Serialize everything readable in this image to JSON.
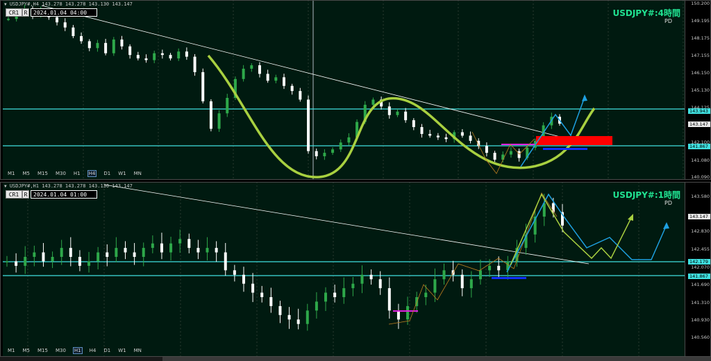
{
  "top": {
    "symbol_line": "USDJPY#,H4 143.278 143.278 143.130 143.147",
    "cr_label": "CR1",
    "r_label": "R",
    "date_label": "2024.01.04 04:00",
    "title": "USDJPY#:4時間",
    "pd": "PD",
    "timeframes": [
      "M1",
      "M5",
      "M15",
      "M30",
      "H1",
      "H4",
      "D1",
      "W1",
      "MN"
    ],
    "active_timeframe": "H4",
    "price_ticks": [
      "150.200",
      "149.195",
      "148.175",
      "147.155",
      "146.150",
      "145.130",
      "144.125",
      "143.105",
      "142.100",
      "141.080",
      "140.090"
    ],
    "levels": {
      "upper": "143.943",
      "current": "143.147",
      "lower": "141.867"
    }
  },
  "bottom": {
    "symbol_line": "USDJPY#,H1 143.278 143.278 143.130 143.147",
    "cr_label": "CR1",
    "r_label": "R",
    "date_label": "2024.01.04 01:00",
    "title": "USDJPY#:1時間",
    "pd": "PD",
    "timeframes": [
      "M1",
      "M5",
      "M15",
      "M30",
      "H1",
      "H4",
      "D1",
      "W1",
      "MN"
    ],
    "active_timeframe": "H1",
    "price_ticks": [
      "143.580",
      "143.147",
      "142.830",
      "142.455",
      "142.070",
      "141.690",
      "141.310",
      "140.930",
      "140.560"
    ],
    "levels": {
      "current": "143.147",
      "upper": "142.179",
      "lower": "141.867"
    }
  },
  "colors": {
    "background": "#001a10",
    "bull": "#2ea84a",
    "bear": "#ffffff",
    "level_line": "#40e0e0",
    "trend_line": "#ffffff",
    "curve": "#a8d040",
    "forecast": "#1ea0e0",
    "zone_red": "#ff0000",
    "zone_blue": "#1030ff",
    "zone_magenta": "#e020e0",
    "title": "#20e090"
  },
  "chart_data": [
    {
      "type": "candlestick",
      "timeframe": "H4",
      "ylim": [
        140.09,
        150.2
      ],
      "close_path": [
        149.3,
        149.6,
        149.9,
        149.5,
        149.8,
        149.4,
        149.1,
        148.8,
        148.3,
        148.0,
        147.6,
        147.9,
        147.3,
        148.1,
        147.7,
        147.2,
        147.0,
        146.9,
        147.3,
        147.2,
        147.0,
        147.4,
        147.1,
        146.2,
        144.5,
        142.9,
        143.8,
        144.7,
        145.8,
        146.4,
        146.6,
        146.1,
        145.7,
        145.9,
        145.4,
        145.1,
        144.6,
        141.6,
        141.3,
        141.5,
        141.7,
        142.1,
        142.4,
        143.3,
        144.3,
        144.6,
        144.2,
        143.7,
        143.9,
        143.4,
        143.0,
        142.6,
        142.5,
        142.4,
        142.3,
        142.7,
        142.5,
        142.2,
        141.9,
        141.5,
        141.1,
        141.4,
        141.6,
        141.2,
        141.8,
        142.2,
        143.1,
        143.6,
        143.2
      ]
    },
    {
      "type": "candlestick",
      "timeframe": "H1",
      "ylim": [
        140.5,
        143.65
      ],
      "close_path": [
        142.2,
        142.1,
        142.3,
        142.4,
        142.2,
        142.3,
        142.5,
        142.3,
        142.1,
        142.2,
        142.4,
        142.3,
        142.5,
        142.4,
        142.3,
        142.5,
        142.6,
        142.4,
        142.6,
        142.7,
        142.5,
        142.4,
        142.5,
        142.4,
        142.0,
        141.9,
        141.7,
        141.5,
        141.4,
        141.2,
        141.0,
        140.9,
        140.8,
        141.1,
        141.3,
        141.5,
        141.4,
        141.6,
        141.7,
        141.9,
        141.8,
        141.6,
        141.1,
        140.9,
        141.2,
        141.4,
        141.5,
        141.8,
        142.0,
        141.9,
        141.6,
        141.8,
        142.0,
        142.1,
        142.0,
        142.2,
        142.5,
        142.8,
        143.2,
        143.5,
        143.3,
        143.0
      ]
    }
  ]
}
